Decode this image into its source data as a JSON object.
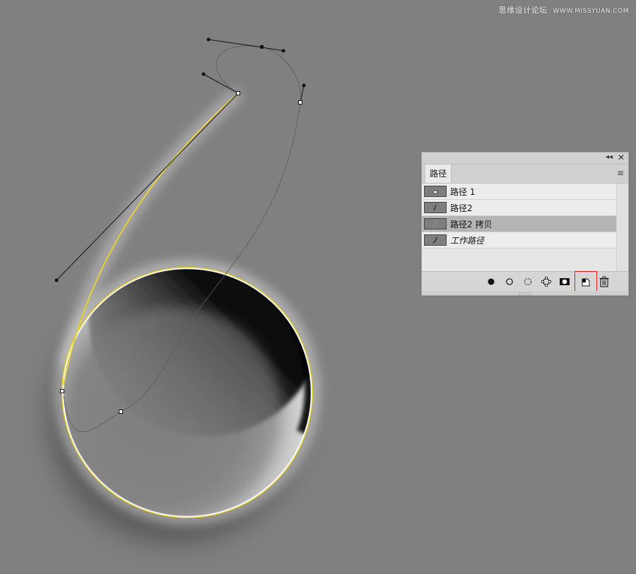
{
  "watermark": {
    "site_name": "思缘设计论坛",
    "site_url": "WWW.MISSYUAN.COM"
  },
  "icons": {
    "collapse": "double-chevron-left-icon",
    "close": "close-icon",
    "panel_menu": "hamburger-menu-icon",
    "fill_path": "fill-path-icon",
    "stroke_path": "stroke-path-icon",
    "load_selection": "load-selection-icon",
    "make_work_path": "work-path-from-selection-icon",
    "add_mask": "add-mask-icon",
    "new_path": "new-path-icon",
    "delete_path": "trash-icon"
  },
  "colors": {
    "canvas_bg": "#808080",
    "path_yellow": "#d8c21a",
    "highlight_box": "#e01b1b",
    "selected_row": "#b4b4b4"
  },
  "paths_panel": {
    "tab_label": "路径",
    "collapse_glyph": "◂◂",
    "close_glyph": "✕",
    "menu_glyph": "≡",
    "items": [
      {
        "label": "路径 1",
        "selected": false,
        "italic": false
      },
      {
        "label": "路径2",
        "selected": false,
        "italic": false
      },
      {
        "label": "路径2 拷贝",
        "selected": true,
        "italic": false
      },
      {
        "label": "工作路径",
        "selected": false,
        "italic": true
      }
    ]
  }
}
